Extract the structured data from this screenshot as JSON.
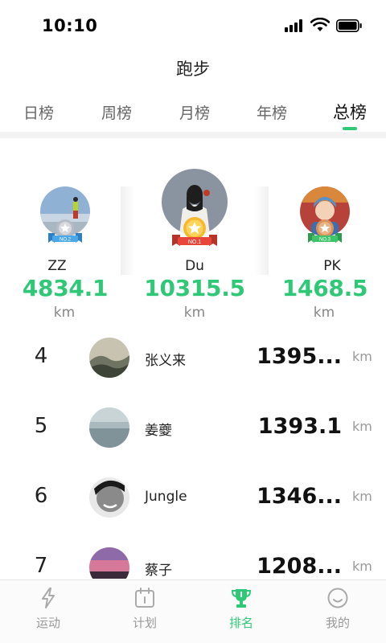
{
  "status_bar": {
    "time": "10:10"
  },
  "header": {
    "title": "跑步"
  },
  "tabs": [
    {
      "label": "日榜",
      "active": false
    },
    {
      "label": "周榜",
      "active": false
    },
    {
      "label": "月榜",
      "active": false
    },
    {
      "label": "年榜",
      "active": false
    },
    {
      "label": "总榜",
      "active": true
    }
  ],
  "podium": {
    "second": {
      "name": "ZZ",
      "distance": "4834.1",
      "unit": "km",
      "medal_text": "NO.2",
      "medal_color": "#4aa8e8"
    },
    "first": {
      "name": "Du",
      "distance": "10315.5",
      "unit": "km",
      "medal_text": "NO.1",
      "medal_color": "#e8463a"
    },
    "third": {
      "name": "PK",
      "distance": "1468.5",
      "unit": "km",
      "medal_text": "NO.3",
      "medal_color": "#3fc46a"
    }
  },
  "list": [
    {
      "rank": "4",
      "name": "张义来",
      "distance": "1395...",
      "unit": "km"
    },
    {
      "rank": "5",
      "name": "姜夔",
      "distance": "1393.1",
      "unit": "km"
    },
    {
      "rank": "6",
      "name": "Jungle",
      "distance": "1346...",
      "unit": "km"
    },
    {
      "rank": "7",
      "name": "蔡子",
      "distance": "1208...",
      "unit": "km"
    }
  ],
  "bottom_nav": [
    {
      "label": "运动",
      "icon": "lightning-icon",
      "active": false
    },
    {
      "label": "计划",
      "icon": "calendar-icon",
      "active": false
    },
    {
      "label": "排名",
      "icon": "trophy-icon",
      "active": true
    },
    {
      "label": "我的",
      "icon": "smiley-icon",
      "active": false
    }
  ],
  "colors": {
    "accent": "#2fc877",
    "gold": "#f5b82e",
    "silver": "#b8bcc6",
    "bronze": "#d9925a"
  }
}
